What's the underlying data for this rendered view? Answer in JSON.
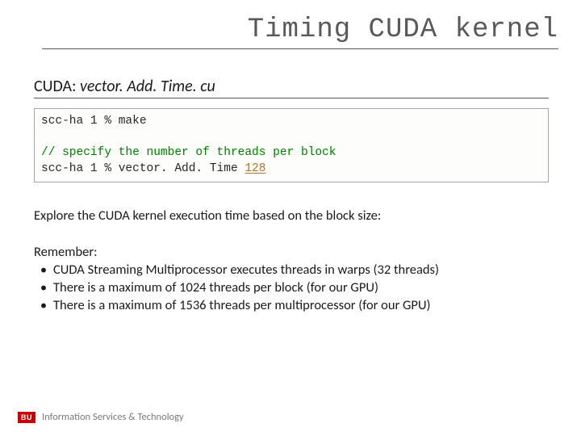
{
  "title": "Timing CUDA kernel",
  "section": {
    "prefix": "CUDA: ",
    "filename": "vector. Add. Time. cu"
  },
  "code": {
    "line1_prompt": "scc-ha 1 % ",
    "line1_cmd": "make",
    "comment": "// specify the number of threads per block",
    "line2_prompt": "scc-ha 1 % ",
    "line2_cmd": "vector. Add. Time ",
    "line2_arg": "128"
  },
  "explore_text": "Explore the CUDA kernel execution time based on the block size:",
  "remember": {
    "heading": "Remember:",
    "bullets": [
      "CUDA Streaming Multiprocessor executes threads in warps (32 threads)",
      "There is a maximum of 1024 threads per block (for our GPU)",
      "There is a maximum of 1536 threads per multiprocessor (for our GPU)"
    ]
  },
  "footer": {
    "logo": "BU",
    "org": "Information Services & Technology"
  }
}
